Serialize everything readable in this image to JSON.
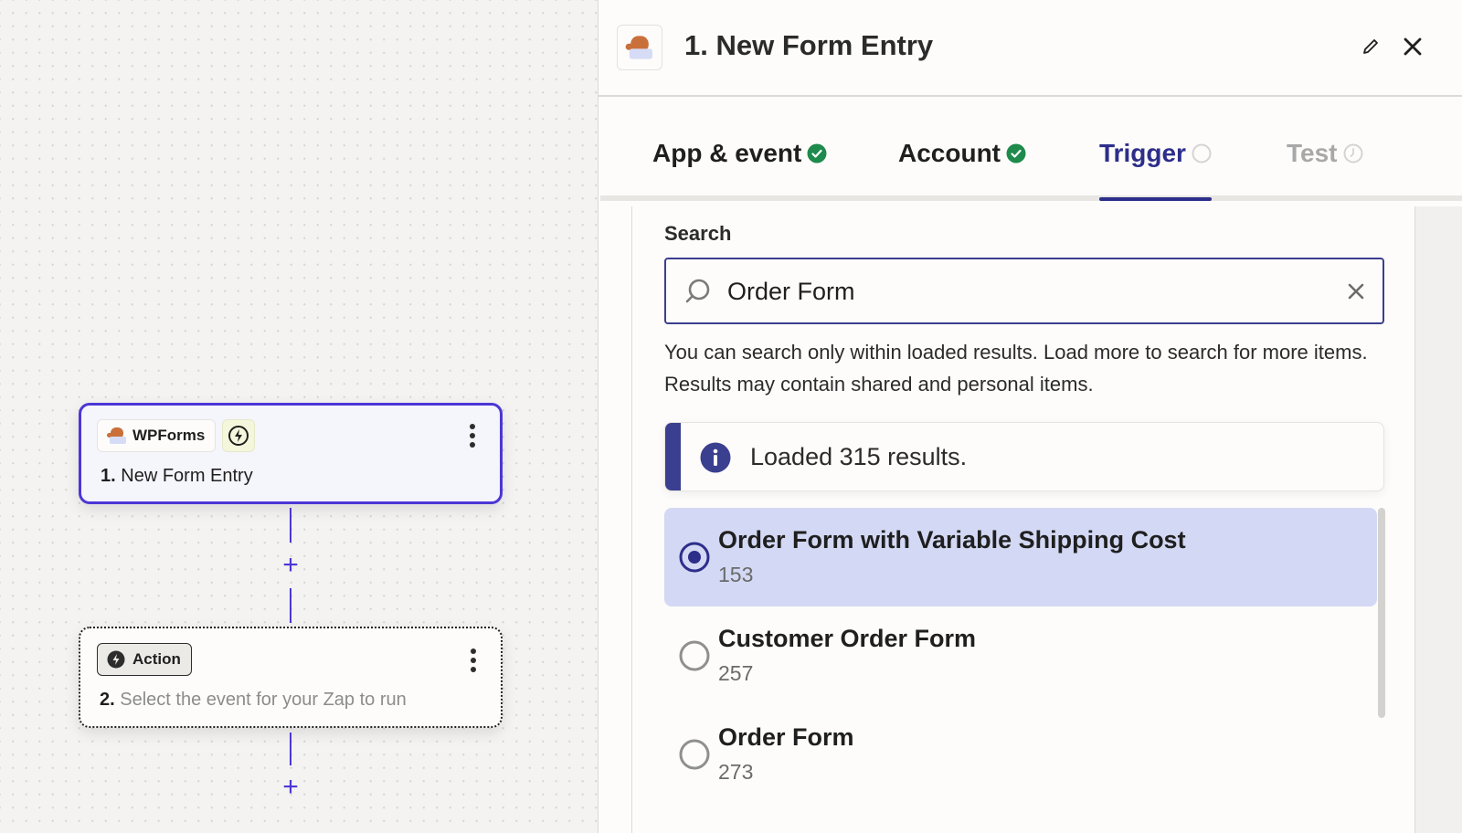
{
  "canvas": {
    "trigger_step": {
      "app_name": "WPForms",
      "step_number": "1.",
      "title": "New Form Entry",
      "type_icon": "lightning-icon"
    },
    "action_step": {
      "chip_label": "Action",
      "step_number": "2.",
      "placeholder": "Select the event for your Zap to run"
    },
    "add_step_symbol": "+"
  },
  "panel": {
    "title": "1. New Form Entry",
    "app_icon": "wpforms-mascot-icon",
    "edit_icon": "pencil-icon",
    "close_icon": "close-icon",
    "tabs": [
      {
        "label": "App & event",
        "status": "complete"
      },
      {
        "label": "Account",
        "status": "complete"
      },
      {
        "label": "Trigger",
        "status": "active"
      },
      {
        "label": "Test",
        "status": "pending"
      }
    ],
    "search": {
      "label": "Search",
      "value": "Order Form",
      "placeholder": "Search"
    },
    "help_text": "You can search only within loaded results. Load more to search for more items. Results may contain shared and personal items.",
    "alert": {
      "text": "Loaded 315 results."
    },
    "options": [
      {
        "label": "Order Form with Variable Shipping Cost",
        "id": "153",
        "selected": true
      },
      {
        "label": "Customer Order Form",
        "id": "257",
        "selected": false
      },
      {
        "label": "Order Form",
        "id": "273",
        "selected": false
      }
    ]
  },
  "colors": {
    "accent": "#4b37d6",
    "tab_active": "#2d2e8a",
    "success": "#1e8a4c",
    "selected_bg": "#d3d8f4"
  }
}
